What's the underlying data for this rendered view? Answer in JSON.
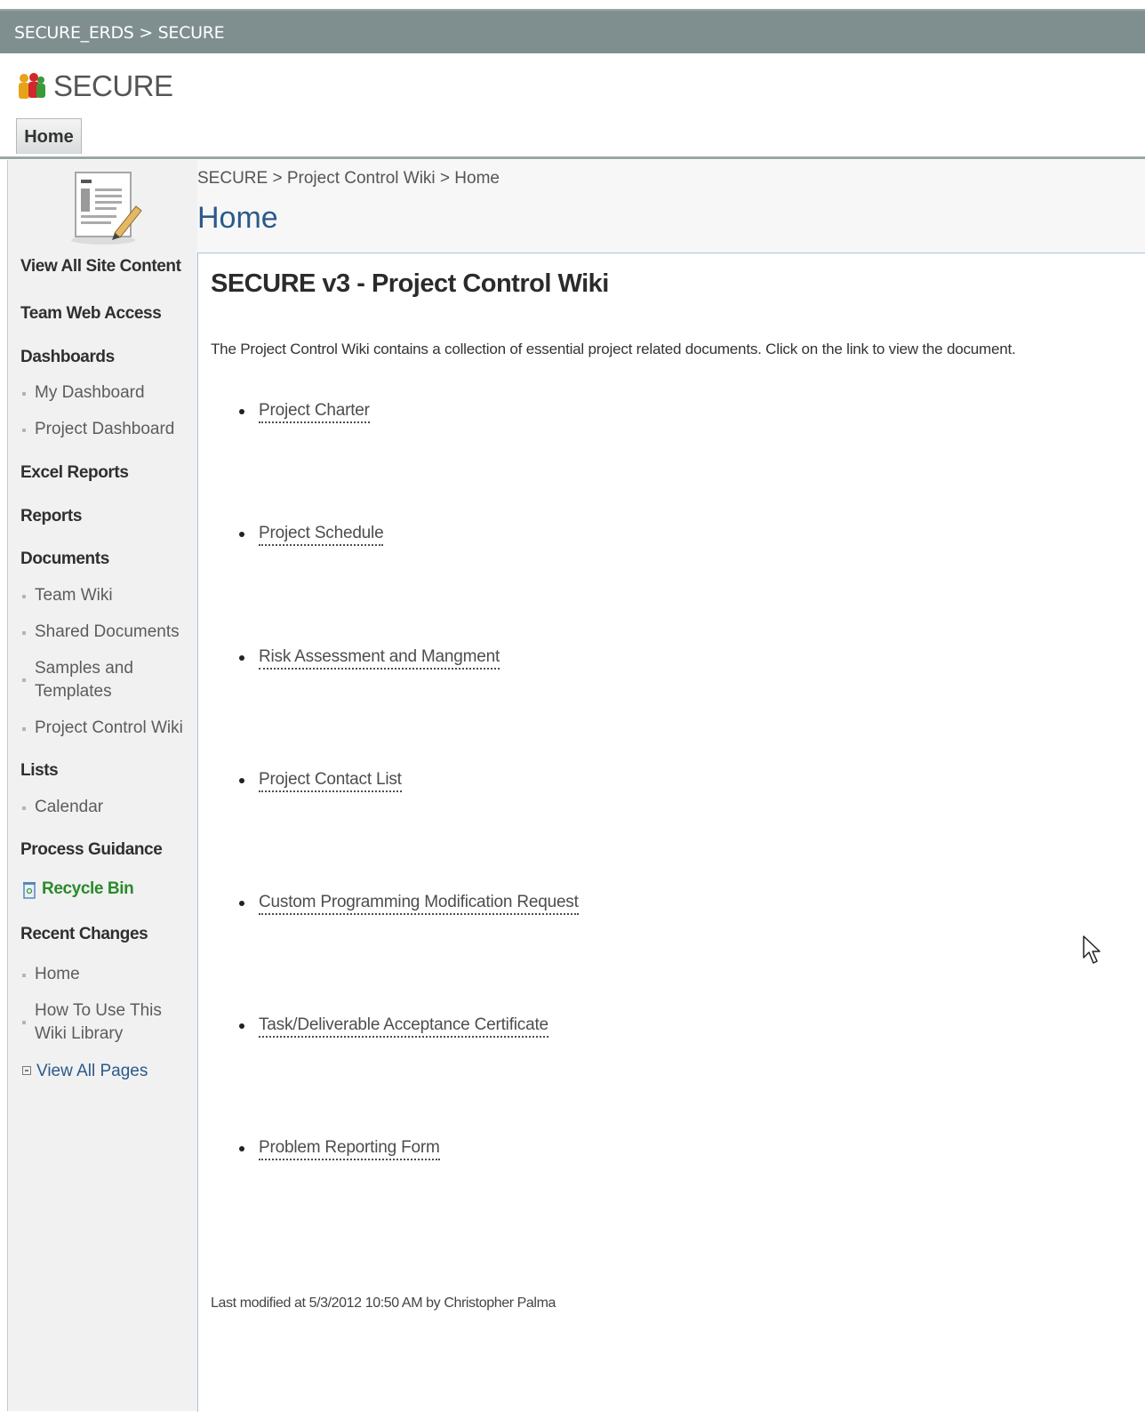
{
  "topbar": {
    "breadcrumb": [
      "SECURE_ERDS",
      ">",
      "SECURE"
    ]
  },
  "header": {
    "site_title": "SECURE",
    "logo_icon": "sharepoint-people-icon",
    "tabs": [
      {
        "label": "Home",
        "selected": true
      }
    ]
  },
  "sidebar": {
    "site_icon": "wiki-document-pencil-icon",
    "view_all": "View All Site Content",
    "sections": [
      {
        "heading": "Team Web Access",
        "items": []
      },
      {
        "heading": "Dashboards",
        "items": [
          "My Dashboard",
          "Project Dashboard"
        ]
      },
      {
        "heading": "Excel Reports",
        "items": []
      },
      {
        "heading": "Reports",
        "items": []
      },
      {
        "heading": "Documents",
        "items": [
          "Team Wiki",
          "Shared Documents",
          "Samples and Templates",
          "Project Control Wiki"
        ]
      },
      {
        "heading": "Lists",
        "items": [
          "Calendar"
        ]
      },
      {
        "heading": "Process Guidance",
        "items": []
      }
    ],
    "recycle_bin": "Recycle Bin",
    "recent_changes": {
      "heading": "Recent Changes",
      "items": [
        "Home",
        "How To Use This Wiki Library"
      ]
    },
    "view_all_pages": "View All Pages"
  },
  "main": {
    "breadcrumb": "SECURE > Project Control Wiki > Home",
    "page_title": "Home",
    "heading": "SECURE v3 - Project Control Wiki",
    "intro": "The Project Control Wiki contains a collection of essential project related documents.  Click on the link to view the document.",
    "documents": [
      "Project Charter",
      "Project Schedule",
      "Risk Assessment and Mangment",
      "Project Contact List",
      "Custom Programming Modification Request",
      "Task/Deliverable Acceptance Certificate",
      "Problem Reporting Form"
    ],
    "last_modified": "Last modified at 5/3/2012 10:50 AM  by Christopher Palma"
  },
  "colors": {
    "topbar_bg": "#7f8f8f",
    "title_blue": "#2a5a8a",
    "recycle_green": "#2a8a2a",
    "link_blue": "#2a5a8a"
  }
}
